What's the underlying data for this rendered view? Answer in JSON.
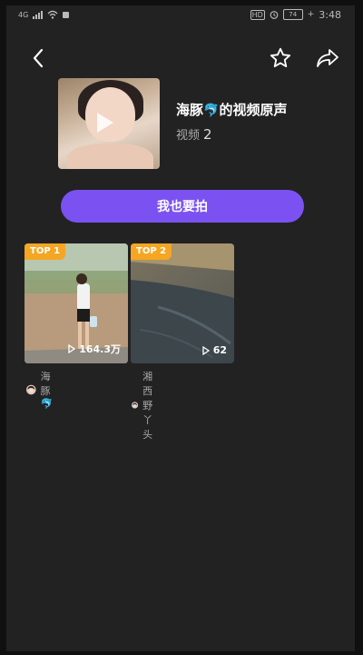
{
  "status": {
    "carrier": "4G",
    "battery": "74",
    "time": "3:48"
  },
  "nav": {
    "back_icon": "chevron-left-icon",
    "favorite_icon": "star-outline-icon",
    "share_icon": "share-arrow-icon"
  },
  "sound": {
    "title_part1": "海豚",
    "title_emoji": "🐬",
    "title_part2": "的视频原声",
    "count_label": "视频",
    "count_value": "2"
  },
  "action": {
    "shoot_label": "我也要拍"
  },
  "videos": [
    {
      "tag": "TOP 1",
      "views": "164.3万",
      "author": "海豚",
      "author_emoji": "🐬"
    },
    {
      "tag": "TOP 2",
      "views": "62",
      "author": "湘西野丫头",
      "author_emoji": ""
    }
  ],
  "colors": {
    "accent": "#7b52f1",
    "tag": "#f5a623",
    "background": "#222223"
  }
}
